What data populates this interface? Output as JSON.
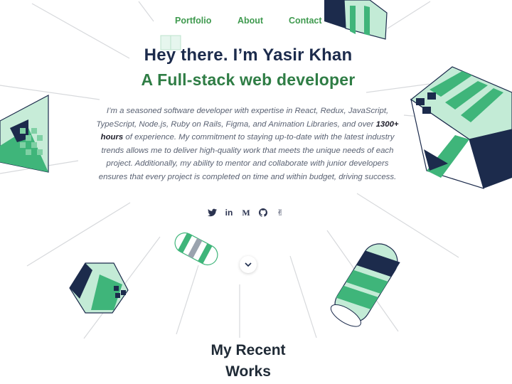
{
  "nav": {
    "items": [
      "Portfolio",
      "About",
      "Contact"
    ]
  },
  "hero": {
    "greeting": "Hey there. I’m Yasir Khan",
    "role": "A Full-stack web developer",
    "bio_before": "I’m a seasoned software developer with expertise in React, Redux, JavaScript, TypeScript, Node.js, Ruby on Rails, Figma, and Animation Libraries, and over ",
    "bio_bold": "1300+ hours",
    "bio_after": " of experience. My commitment to staying up-to-date with the latest industry trends allows me to deliver high-quality work that meets the unique needs of each project. Additionally, my ability to mentor and collaborate with junior developers ensures that every project is completed on time and within budget, driving success."
  },
  "social": [
    {
      "icon": "twitter-icon",
      "glyph": "🐦"
    },
    {
      "icon": "linkedin-icon",
      "glyph": "in"
    },
    {
      "icon": "medium-icon",
      "glyph": "M"
    },
    {
      "icon": "github-icon",
      "glyph": "🐙"
    },
    {
      "icon": "angellist-icon",
      "glyph": "✌"
    }
  ],
  "scroll": {
    "icon": "chevron-down-icon"
  },
  "works": {
    "title_line1": "My Recent",
    "title_line2": "Works"
  },
  "colors": {
    "navy": "#1c2b4c",
    "green": "#3fb57a",
    "mint": "#bfe9d3",
    "accent": "#2f7d45"
  }
}
